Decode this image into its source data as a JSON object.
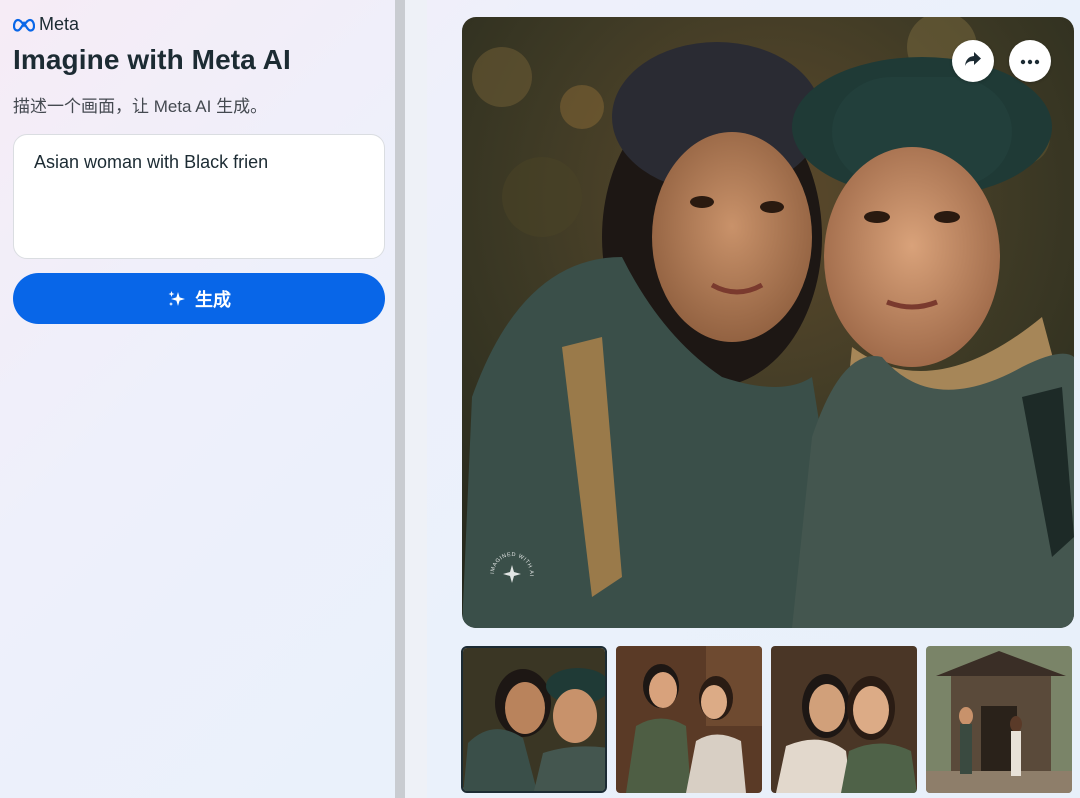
{
  "brand": {
    "name": "Meta",
    "icon": "meta-infinity-logo"
  },
  "header": {
    "title": "Imagine with Meta AI",
    "subtitle": "描述一个画面，让 Meta AI 生成。"
  },
  "prompt": {
    "value": "Asian woman with Black frien"
  },
  "generate_button": {
    "label": "生成",
    "icon": "sparkle-icon"
  },
  "image_actions": {
    "share_icon": "share-arrow-icon",
    "more_icon": "more-dots-icon"
  },
  "watermark": {
    "text": "IMAGINED WITH AI"
  },
  "thumbnails": [
    {
      "selected": true
    },
    {
      "selected": false
    },
    {
      "selected": false
    },
    {
      "selected": false
    }
  ],
  "colors": {
    "accent": "#0866e8",
    "title": "#1c2b33"
  }
}
